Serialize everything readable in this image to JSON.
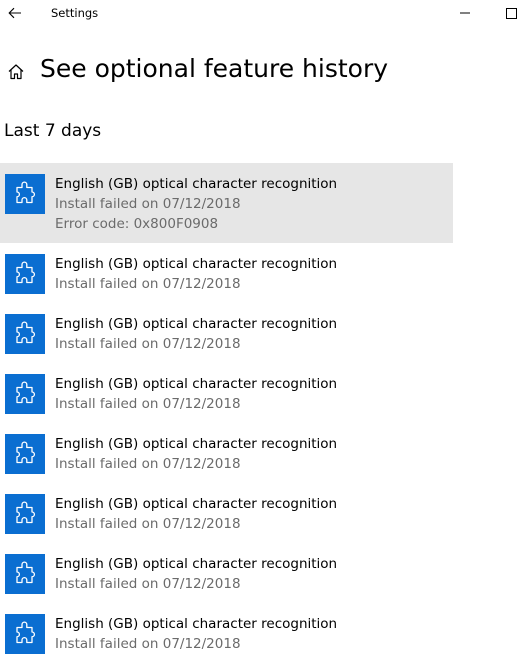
{
  "window": {
    "app_title": "Settings"
  },
  "header": {
    "title": "See optional feature history"
  },
  "section": {
    "title": "Last 7 days"
  },
  "colors": {
    "icon_tile": "#0a6ed1",
    "selected_row": "#e6e6e6",
    "secondary_text": "#6b6b6b"
  },
  "items": [
    {
      "name": "English (GB) optical character recognition",
      "status": "Install failed on 07/12/2018",
      "error": "Error code: 0x800F0908",
      "icon": "puzzle-piece-icon"
    },
    {
      "name": "English (GB) optical character recognition",
      "status": "Install failed on 07/12/2018",
      "icon": "puzzle-piece-icon"
    },
    {
      "name": "English (GB) optical character recognition",
      "status": "Install failed on 07/12/2018",
      "icon": "puzzle-piece-icon"
    },
    {
      "name": "English (GB) optical character recognition",
      "status": "Install failed on 07/12/2018",
      "icon": "puzzle-piece-icon"
    },
    {
      "name": "English (GB) optical character recognition",
      "status": "Install failed on 07/12/2018",
      "icon": "puzzle-piece-icon"
    },
    {
      "name": "English (GB) optical character recognition",
      "status": "Install failed on 07/12/2018",
      "icon": "puzzle-piece-icon"
    },
    {
      "name": "English (GB) optical character recognition",
      "status": "Install failed on 07/12/2018",
      "icon": "puzzle-piece-icon"
    },
    {
      "name": "English (GB) optical character recognition",
      "status": "Install failed on 07/12/2018",
      "icon": "puzzle-piece-icon"
    }
  ]
}
